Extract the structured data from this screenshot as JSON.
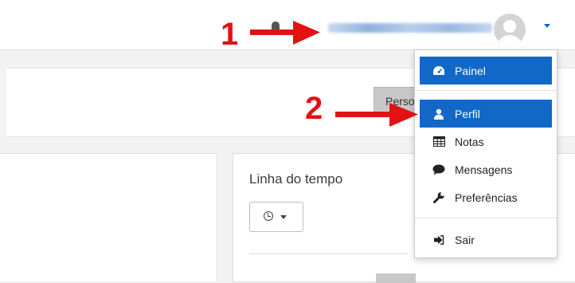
{
  "header": {
    "bell_icon": "bell-icon",
    "avatar_icon": "user-avatar",
    "user_menu_caret": "caret-down-icon"
  },
  "page_header": {
    "customise_button_partial": "Perso"
  },
  "timeline": {
    "title": "Linha do tempo",
    "filter_icon": "clock-icon"
  },
  "user_menu": {
    "items": [
      {
        "label": "Painel",
        "icon": "dashboard-icon"
      },
      {
        "label": "Perfil",
        "icon": "user-icon"
      },
      {
        "label": "Notas",
        "icon": "table-icon"
      },
      {
        "label": "Mensagens",
        "icon": "comment-icon"
      },
      {
        "label": "Preferências",
        "icon": "wrench-icon"
      },
      {
        "label": "Sair",
        "icon": "sign-out-icon"
      }
    ],
    "active_color": "#1168c7"
  },
  "annotations": {
    "step1": "1",
    "step2": "2",
    "color": "#e31212"
  }
}
